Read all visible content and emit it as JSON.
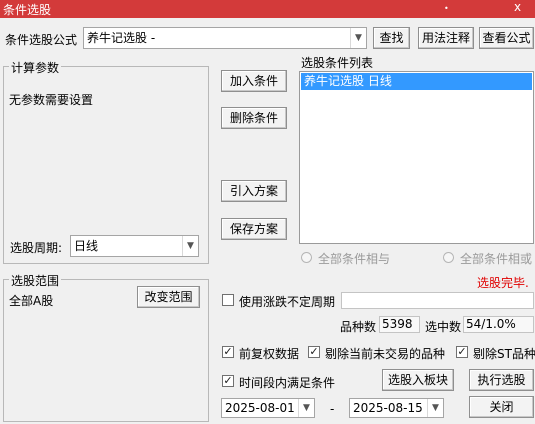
{
  "window": {
    "title": "条件选股",
    "controls": {
      "close": "x",
      "extra": "•"
    }
  },
  "formula": {
    "label": "条件选股公式",
    "value": "养牛记选股  -",
    "buttons": {
      "find": "查找",
      "usage": "用法注释",
      "view": "查看公式"
    }
  },
  "params": {
    "legend": "计算参数",
    "text": "无参数需要设置",
    "period_label": "选股周期:",
    "period_value": "日线"
  },
  "conditions": {
    "add": "加入条件",
    "remove": "删除条件",
    "import": "引入方案",
    "save": "保存方案",
    "list_label": "选股条件列表",
    "items": [
      "养牛记选股  日线"
    ]
  },
  "logic": {
    "and": "全部条件相与",
    "or": "全部条件相或"
  },
  "status": {
    "text": "选股完毕.",
    "color": "#e00000"
  },
  "scope": {
    "legend": "选股范围",
    "value": "全部A股",
    "change": "改变范围"
  },
  "period_option": {
    "label": "使用涨跌不定周期",
    "checked": false
  },
  "stats": {
    "count_label": "品种数",
    "count": "5398",
    "hit_label": "选中数",
    "hit": "54/1.0%"
  },
  "options": [
    {
      "label": "前复权数据",
      "checked": true
    },
    {
      "label": "剔除当前未交易的品种",
      "checked": true
    },
    {
      "label": "剔除ST品种",
      "checked": true
    }
  ],
  "time_range": {
    "label": "时间段内满足条件",
    "checked": true,
    "start": "2025-08-01",
    "sep": "-",
    "end": "2025-08-15"
  },
  "actions": {
    "to_block": "选股入板块",
    "run": "执行选股",
    "close": "关闭"
  }
}
